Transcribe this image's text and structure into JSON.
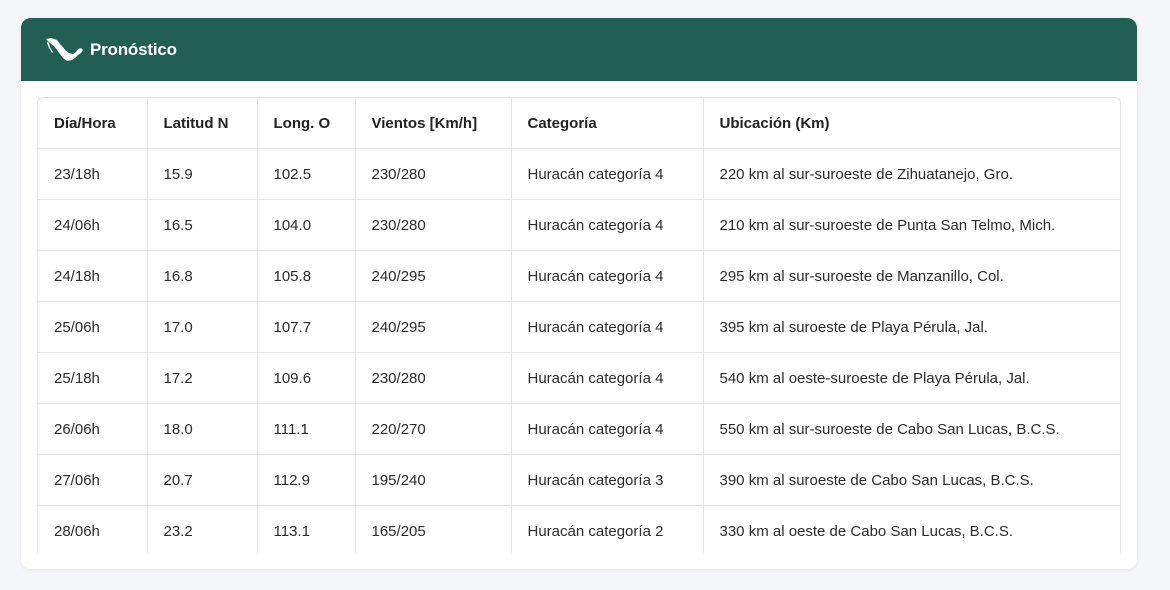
{
  "header": {
    "title": "Pronóstico",
    "icon": "mexico-map-icon",
    "background_color": "#225e51"
  },
  "table": {
    "columns": [
      "Día/Hora",
      "Latitud N",
      "Long. O",
      "Vientos [Km/h]",
      "Categoría",
      "Ubicación (Km)"
    ],
    "rows": [
      [
        "23/18h",
        "15.9",
        "102.5",
        "230/280",
        "Huracán categoría 4",
        "220 km al sur-suroeste de Zihuatanejo, Gro."
      ],
      [
        "24/06h",
        "16.5",
        "104.0",
        "230/280",
        "Huracán categoría 4",
        "210 km al sur-suroeste de Punta San Telmo, Mich."
      ],
      [
        "24/18h",
        "16.8",
        "105.8",
        "240/295",
        "Huracán categoría 4",
        "295 km al sur-suroeste de Manzanillo, Col."
      ],
      [
        "25/06h",
        "17.0",
        "107.7",
        "240/295",
        "Huracán categoría 4",
        "395 km al suroeste de Playa Pérula, Jal."
      ],
      [
        "25/18h",
        "17.2",
        "109.6",
        "230/280",
        "Huracán categoría 4",
        "540 km al oeste-suroeste de Playa Pérula, Jal."
      ],
      [
        "26/06h",
        "18.0",
        "111.1",
        "220/270",
        "Huracán categoría 4",
        "550 km al sur-suroeste de Cabo San Lucas, B.C.S."
      ],
      [
        "27/06h",
        "20.7",
        "112.9",
        "195/240",
        "Huracán categoría 3",
        "390 km al suroeste de Cabo San Lucas, B.C.S."
      ],
      [
        "28/06h",
        "23.2",
        "113.1",
        "165/205",
        "Huracán categoría 2",
        "330 km al oeste de Cabo San Lucas, B.C.S."
      ]
    ]
  }
}
